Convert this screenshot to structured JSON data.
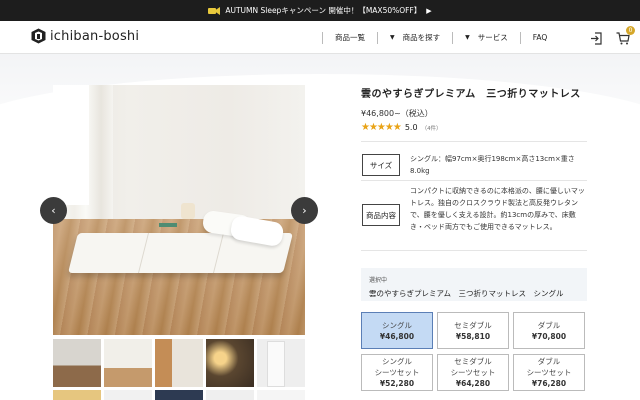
{
  "promo": {
    "text": "AUTUMN Sleepキャンペーン 開催中！【MAX50%OFF】",
    "arrow": "▶"
  },
  "header": {
    "logo_text": "ichiban-boshi",
    "nav": [
      {
        "label": "商品一覧"
      },
      {
        "label": "商品を探す"
      },
      {
        "label": "サービス"
      },
      {
        "label": "FAQ"
      }
    ],
    "cart_count": "0"
  },
  "product": {
    "title": "雲のやすらぎプレミアム　三つ折りマットレス",
    "price": "¥46,800~（税込）",
    "stars": "★★★★★",
    "rating": "5.0",
    "review_count": "（4件）",
    "size_label": "サイズ",
    "size_text": "シングル：幅97cm×奥行198cm×高さ13cm×重さ8.0kg",
    "content_label": "商品内容",
    "content_text": "コンパクトに収納できるのに本格派の、腰に優しいマットレス。独自のクロスクラウド製法と高反発ウレタンで、腰を優しく支える設計。約13cmの厚みで、床敷き・ベッド両方でもご使用できるマットレス。",
    "selected_caption": "選択中",
    "selected_value": "雲のやすらぎプレミアム　三つ折りマットレス　シングル"
  },
  "variants": [
    {
      "name": "シングル",
      "price": "¥46,800",
      "active": true
    },
    {
      "name": "セミダブル",
      "price": "¥58,810",
      "active": false
    },
    {
      "name": "ダブル",
      "price": "¥70,800",
      "active": false
    },
    {
      "name": "シングル\nシーツセット",
      "price": "¥52,280",
      "active": false
    },
    {
      "name": "セミダブル\nシーツセット",
      "price": "¥64,280",
      "active": false
    },
    {
      "name": "ダブル\nシーツセット",
      "price": "¥76,280",
      "active": false
    }
  ],
  "gallery": {
    "prev_icon": "‹",
    "next_icon": "›"
  },
  "colors": {
    "accent_star": "#e9a317",
    "active_variant": "#c4daf4",
    "promo_bg": "#1d1d1d",
    "cart_badge": "#d5a72a"
  }
}
